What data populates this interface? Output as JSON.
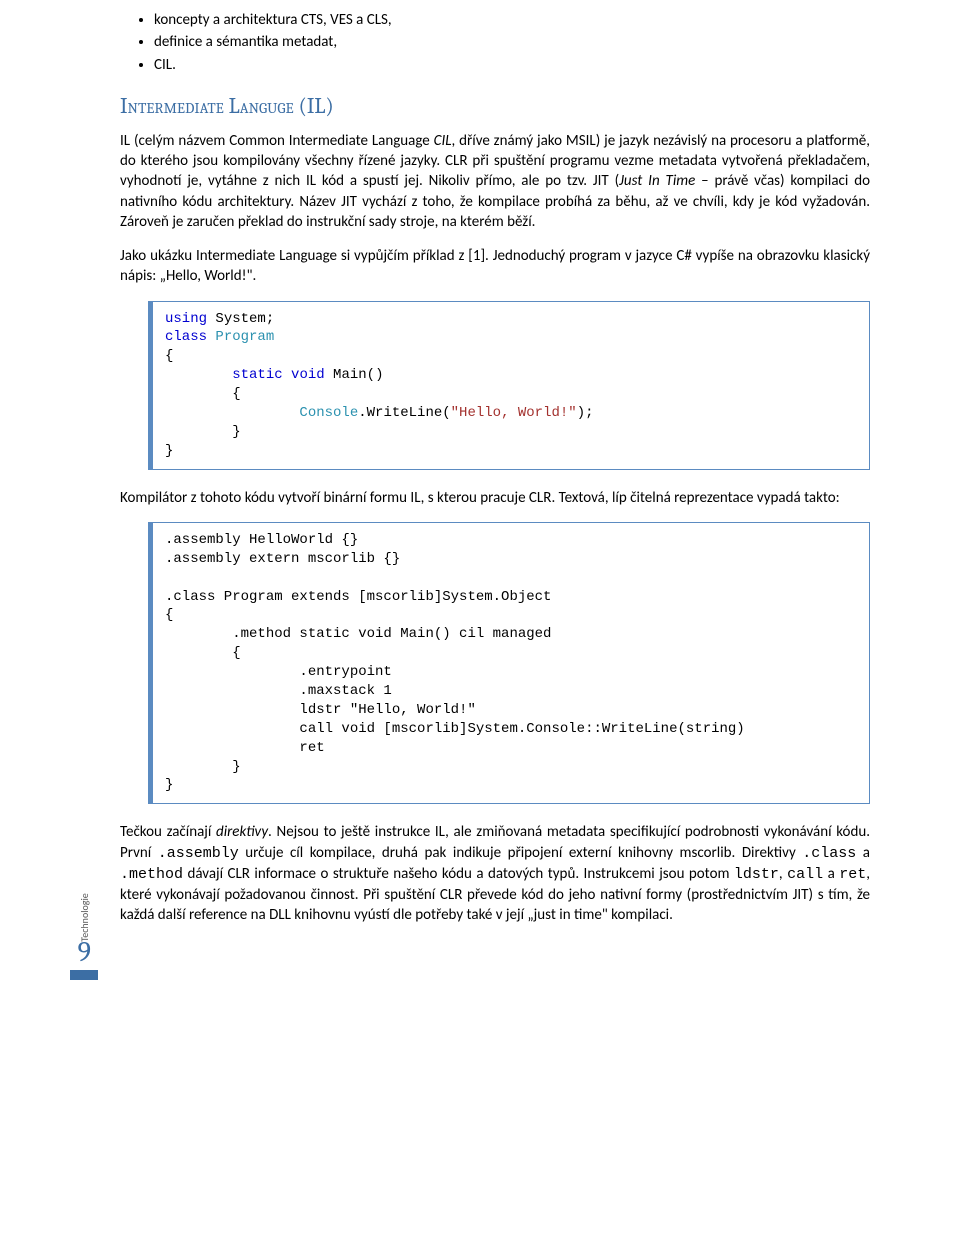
{
  "bullets": {
    "b1": "koncepty a architektura CTS, VES a CLS,",
    "b2": "definice a sémantika metadat,",
    "b3": "CIL."
  },
  "heading": "Intermediate Languge (IL)",
  "para1": {
    "p1a": "IL (celým názvem Common Intermediate Language ",
    "p1b": "CIL",
    "p1c": ", dříve známý jako MSIL) je jazyk nezávislý na procesoru a platformě, do kterého jsou kompilovány všechny řízené jazyky. CLR při spuštění programu vezme metadata vytvořená překladačem, vyhodnotí je, vytáhne z nich IL kód a spustí jej. Nikoliv přímo, ale po tzv. JIT (",
    "p1d": "Just In Time",
    "p1e": " – právě včas) kompilaci do nativního kódu architektury. Název JIT vychází z toho, že kompilace probíhá za běhu, až ve chvíli, kdy je kód vyžadován. Zároveň je zaručen překlad do instrukční sady stroje, na kterém běží."
  },
  "para2": "Jako ukázku Intermediate Language si vypůjčím příklad z [1]. Jednoduchý program v jazyce C# vypíše na obrazovku klasický nápis: „Hello, World!\".",
  "code1": {
    "l1a": "using",
    "l1b": " System;",
    "l2a": "class",
    "l2b": " ",
    "l2c": "Program",
    "l3": "{",
    "l4a": "        ",
    "l4b": "static",
    "l4c": " ",
    "l4d": "void",
    "l4e": " Main()",
    "l5": "        {",
    "l6a": "                ",
    "l6b": "Console",
    "l6c": ".WriteLine(",
    "l6d": "\"Hello, World!\"",
    "l6e": ");",
    "l7": "        }",
    "l8": "}"
  },
  "para3": "Kompilátor z tohoto kódu vytvoří binární formu IL, s kterou pracuje CLR. Textová, líp čitelná reprezentace vypadá takto:",
  "code2": {
    "l1": ".assembly HelloWorld {}",
    "l2": ".assembly extern mscorlib {}",
    "l3": "",
    "l4": ".class Program extends [mscorlib]System.Object",
    "l5": "{",
    "l6": "        .method static void Main() cil managed",
    "l7": "        {",
    "l8": "                .entrypoint",
    "l9": "                .maxstack 1",
    "l10": "                ldstr \"Hello, World!\"",
    "l11": "                call void [mscorlib]System.Console::WriteLine(string)",
    "l12": "                ret",
    "l13": "        }",
    "l14": "}"
  },
  "para4": {
    "a": "Tečkou začínají ",
    "b": "direktivy",
    "c": ". Nejsou to ještě instrukce IL, ale zmiňovaná metadata specifikující podrobnosti vykonávání kódu. První ",
    "d": ".assembly",
    "e": " určuje cíl kompilace, druhá pak indikuje připojení externí knihovny mscorlib. Direktivy ",
    "f": ".class",
    "g": " a ",
    "h": ".method",
    "i": " dávají CLR informace o struktuře našeho kódu a datových typů. Instrukcemi jsou potom ",
    "j": "ldstr",
    "k": ", ",
    "l": "call",
    "m": " a ",
    "n": "ret",
    "o": ", které vykonávají požadovanou činnost. Při spuštění CLR převede kód do jeho nativní formy (prostřednictvím JIT) s tím, že každá další reference na DLL knihovnu vyústí dle potřeby také v její „just in time\" kompilaci."
  },
  "footer": {
    "label": "Technologie",
    "page": "9"
  }
}
